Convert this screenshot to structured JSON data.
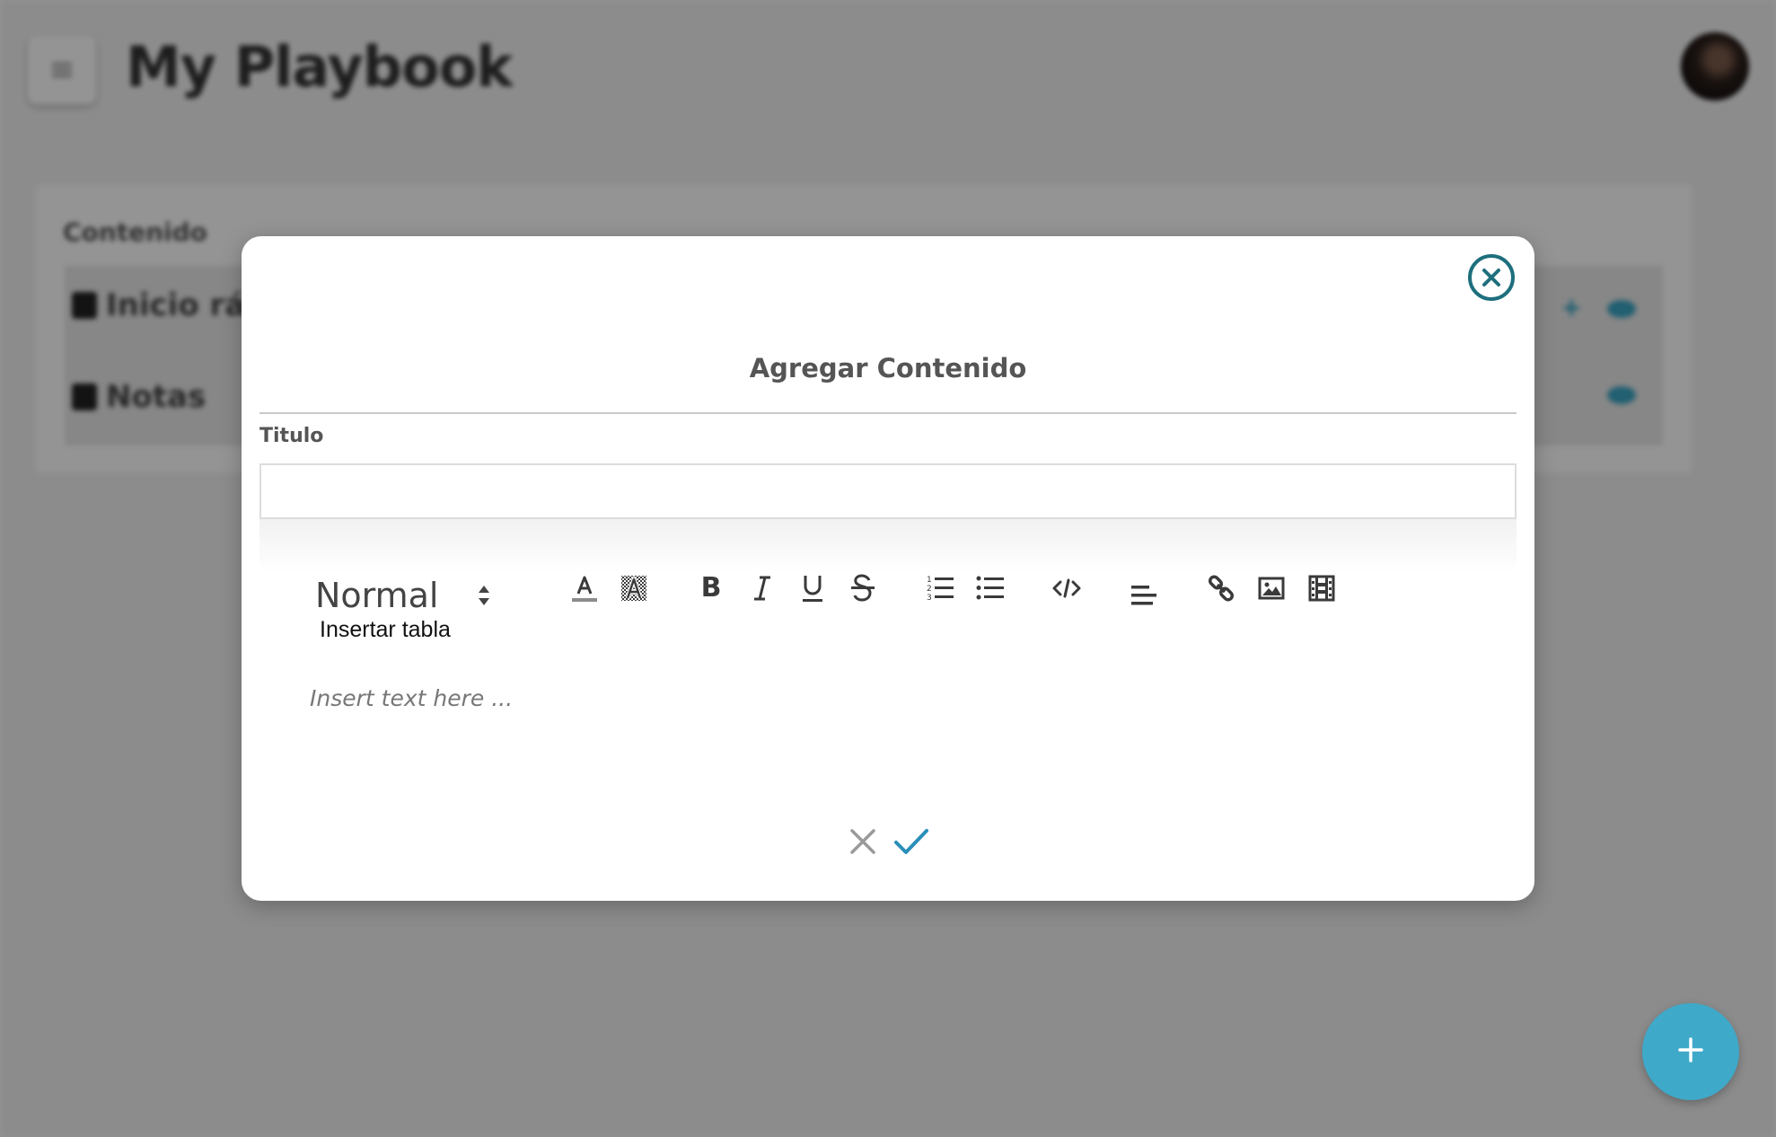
{
  "background_page": {
    "app_title": "My Playbook",
    "menu_icon": "hamburger-icon",
    "content_card": {
      "title": "Contenido",
      "rows": [
        {
          "label": "Inicio rá",
          "icon": "page-icon"
        },
        {
          "label": "Notas",
          "icon": "page-icon"
        }
      ]
    }
  },
  "modal": {
    "title": "Agregar Contenido",
    "close_icon": "close-circle-icon",
    "field_label": "Titulo",
    "field_value": "",
    "editor": {
      "format_select_value": "Normal",
      "insert_table_label": "Insertar tabla",
      "placeholder": "Insert text here ...",
      "toolbar_icons": [
        "font-color-icon",
        "highlight-icon",
        "bold-icon",
        "italic-icon",
        "underline-icon",
        "strikethrough-icon",
        "ordered-list-icon",
        "unordered-list-icon",
        "code-icon",
        "align-left-icon",
        "link-icon",
        "image-icon",
        "video-icon"
      ]
    },
    "footer": {
      "cancel_icon": "close-icon",
      "confirm_icon": "check-icon"
    }
  },
  "fab": {
    "icon": "plus-icon"
  },
  "colors": {
    "accent": "#3fa9c9",
    "close_ring": "#1e6f7d",
    "confirm_check": "#2a8fba",
    "cancel_x": "#9a9a9a",
    "overlay": "rgba(0,0,0,0.42)"
  }
}
